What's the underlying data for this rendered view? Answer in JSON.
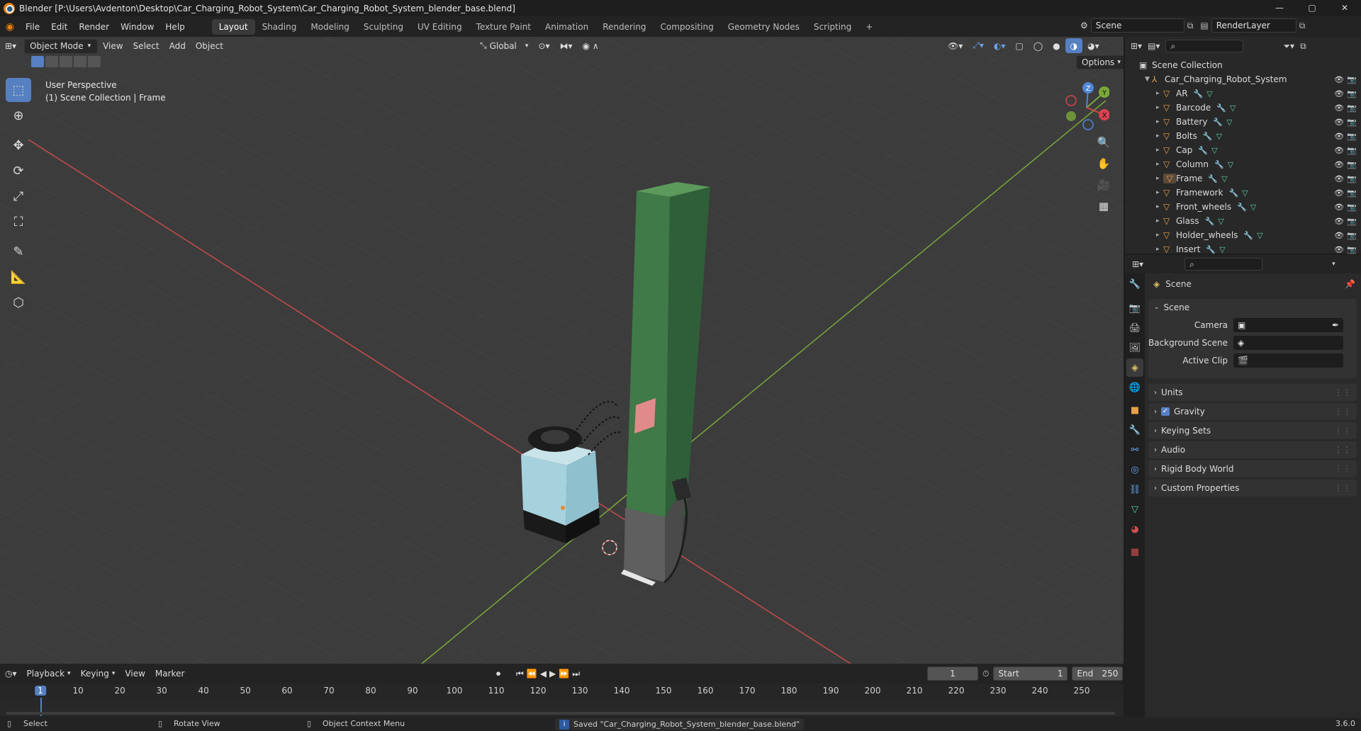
{
  "window": {
    "title": "Blender [P:\\Users\\Avdenton\\Desktop\\Car_Charging_Robot_System\\Car_Charging_Robot_System_blender_base.blend]",
    "minimize": "—",
    "maximize": "▢",
    "close": "✕"
  },
  "menu": [
    "File",
    "Edit",
    "Render",
    "Window",
    "Help"
  ],
  "workspaces": [
    "Layout",
    "Shading",
    "Modeling",
    "Sculpting",
    "UV Editing",
    "Texture Paint",
    "Animation",
    "Rendering",
    "Compositing",
    "Geometry Nodes",
    "Scripting"
  ],
  "workspace_add": "+",
  "scene_name": "Scene",
  "view_layer": "RenderLayer",
  "viewport": {
    "mode": "Object Mode",
    "menus": [
      "View",
      "Select",
      "Add",
      "Object"
    ],
    "orientation": "Global",
    "options_label": "Options",
    "info_line1": "User Perspective",
    "info_line2": "(1) Scene Collection | Frame",
    "gizmo": {
      "z": "Z",
      "y": "Y",
      "x": "X"
    }
  },
  "outliner": {
    "root": "Scene Collection",
    "collection": "Car_Charging_Robot_System",
    "objects": [
      "AR",
      "Barcode",
      "Battery",
      "Bolts",
      "Cap",
      "Column",
      "Frame",
      "Framework",
      "Front_wheels",
      "Glass",
      "Holder_wheels",
      "Insert"
    ]
  },
  "properties": {
    "header_title": "Scene",
    "panel_scene": "Scene",
    "camera_label": "Camera",
    "bg_scene_label": "Background Scene",
    "active_clip_label": "Active Clip",
    "panels": [
      "Units",
      "Gravity",
      "Keying Sets",
      "Audio",
      "Rigid Body World",
      "Custom Properties"
    ],
    "gravity_checked": true
  },
  "timeline": {
    "menus": [
      "Playback",
      "Keying",
      "View",
      "Marker"
    ],
    "current_frame": "1",
    "start_label": "Start",
    "start_value": "1",
    "end_label": "End",
    "end_value": "250",
    "ruler": [
      "1",
      "10",
      "20",
      "30",
      "40",
      "50",
      "60",
      "70",
      "80",
      "90",
      "100",
      "110",
      "120",
      "130",
      "140",
      "150",
      "160",
      "170",
      "180",
      "190",
      "200",
      "210",
      "220",
      "230",
      "240",
      "250"
    ]
  },
  "status": {
    "select": "Select",
    "rotate": "Rotate View",
    "context": "Object Context Menu",
    "message": "Saved \"Car_Charging_Robot_System_blender_base.blend\"",
    "version": "3.6.0"
  },
  "colors": {
    "accent": "#5680c2",
    "object_icon": "#e8a04a",
    "viewport_bg": "#3d3d3d",
    "x_axis": "#c84b4b",
    "y_axis": "#7aa83a"
  }
}
